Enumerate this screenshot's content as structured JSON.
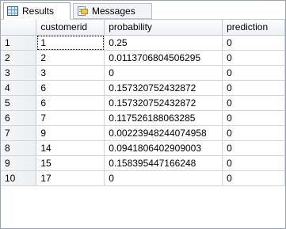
{
  "tabs": [
    {
      "label": "Results",
      "icon": "grid-icon",
      "active": true
    },
    {
      "label": "Messages",
      "icon": "messages-icon",
      "active": false
    }
  ],
  "grid": {
    "columns": [
      "customerid",
      "probability",
      "prediction"
    ],
    "rows": [
      {
        "num": "1",
        "customerid": "1",
        "probability": "0.25",
        "prediction": "0"
      },
      {
        "num": "2",
        "customerid": "2",
        "probability": "0.0113706804506295",
        "prediction": "0"
      },
      {
        "num": "3",
        "customerid": "3",
        "probability": "0",
        "prediction": "0"
      },
      {
        "num": "4",
        "customerid": "6",
        "probability": "0.157320752432872",
        "prediction": "0"
      },
      {
        "num": "5",
        "customerid": "6",
        "probability": "0.157320752432872",
        "prediction": "0"
      },
      {
        "num": "6",
        "customerid": "7",
        "probability": "0.117526188063285",
        "prediction": "0"
      },
      {
        "num": "7",
        "customerid": "9",
        "probability": "0.00223948244074958",
        "prediction": "0"
      },
      {
        "num": "8",
        "customerid": "14",
        "probability": "0.0941806402909003",
        "prediction": "0"
      },
      {
        "num": "9",
        "customerid": "15",
        "probability": "0.158395447166248",
        "prediction": "0"
      },
      {
        "num": "10",
        "customerid": "17",
        "probability": "0",
        "prediction": "0"
      }
    ]
  },
  "colors": {
    "border": "#9aa4b0",
    "gridline": "#d2d6dc",
    "header_bg": "#eef1f5"
  }
}
